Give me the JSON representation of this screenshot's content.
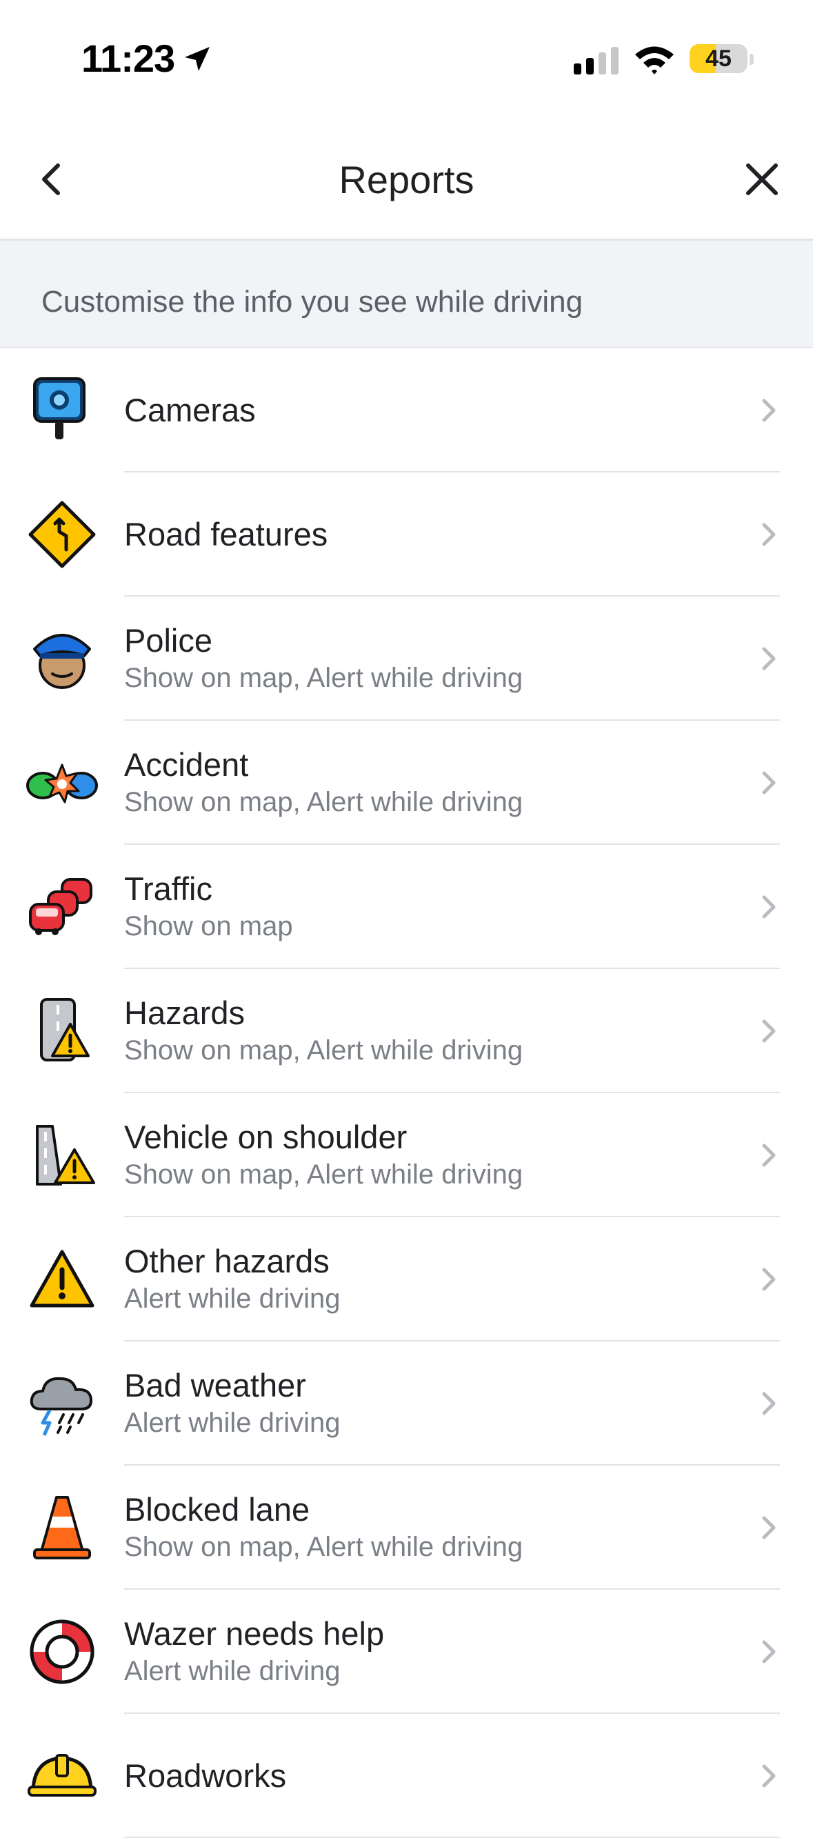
{
  "status_bar": {
    "time": "11:23",
    "battery": "45",
    "battery_level": 0.45
  },
  "nav": {
    "title": "Reports"
  },
  "section": {
    "header": "Customise the info you see while driving"
  },
  "items": [
    {
      "title": "Cameras",
      "subtitle": "",
      "icon": "camera-icon"
    },
    {
      "title": "Road features",
      "subtitle": "",
      "icon": "road-features-icon"
    },
    {
      "title": "Police",
      "subtitle": "Show on map, Alert while driving",
      "icon": "police-icon"
    },
    {
      "title": "Accident",
      "subtitle": "Show on map, Alert while driving",
      "icon": "accident-icon"
    },
    {
      "title": "Traffic",
      "subtitle": "Show on map",
      "icon": "traffic-icon"
    },
    {
      "title": "Hazards",
      "subtitle": "Show on map, Alert while driving",
      "icon": "hazards-icon"
    },
    {
      "title": "Vehicle on shoulder",
      "subtitle": "Show on map, Alert while driving",
      "icon": "vehicle-on-shoulder-icon"
    },
    {
      "title": "Other hazards",
      "subtitle": "Alert while driving",
      "icon": "other-hazards-icon"
    },
    {
      "title": "Bad weather",
      "subtitle": "Alert while driving",
      "icon": "bad-weather-icon"
    },
    {
      "title": "Blocked lane",
      "subtitle": "Show on map, Alert while driving",
      "icon": "blocked-lane-icon"
    },
    {
      "title": "Wazer needs help",
      "subtitle": "Alert while driving",
      "icon": "lifebuoy-icon"
    },
    {
      "title": "Roadworks",
      "subtitle": "",
      "icon": "roadworks-icon"
    }
  ],
  "colors": {
    "accent_yellow": "#ffd21f",
    "police_blue": "#1d6fe0",
    "hazard_yellow": "#ffc400",
    "red": "#e8323c"
  }
}
